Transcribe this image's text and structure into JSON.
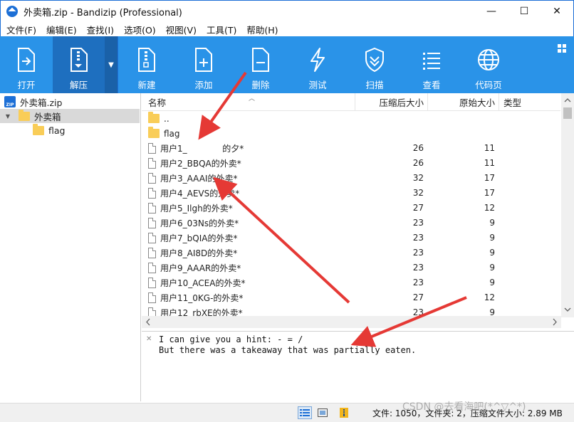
{
  "window": {
    "title": "外卖箱.zip - Bandizip (Professional)",
    "controls": {
      "minimize": "—",
      "maximize": "☐",
      "close": "✕"
    }
  },
  "menu": [
    "文件(F)",
    "编辑(E)",
    "查找(I)",
    "选项(O)",
    "视图(V)",
    "工具(T)",
    "帮助(H)"
  ],
  "toolbar": {
    "open": "打开",
    "extract": "解压",
    "new": "新建",
    "add": "添加",
    "delete": "删除",
    "test": "测试",
    "scan": "扫描",
    "view": "查看",
    "codepage": "代码页"
  },
  "tree": {
    "root": "外卖箱.zip",
    "folder": "外卖箱",
    "child": "flag"
  },
  "columns": {
    "name": "名称",
    "compressed": "压缩后大小",
    "original": "原始大小",
    "type": "类型"
  },
  "rows": [
    {
      "name": "..",
      "csize": "",
      "osize": "",
      "kind": "folder"
    },
    {
      "name": "flag",
      "csize": "",
      "osize": "",
      "kind": "folder"
    },
    {
      "name": "用户1_             的夕*",
      "csize": "26",
      "osize": "11",
      "kind": "file"
    },
    {
      "name": "用户2_BBQA的外卖*",
      "csize": "26",
      "osize": "11",
      "kind": "file"
    },
    {
      "name": "用户3_AAAI的外卖*",
      "csize": "32",
      "osize": "17",
      "kind": "file"
    },
    {
      "name": "用户4_AEVS的外卖*",
      "csize": "32",
      "osize": "17",
      "kind": "file"
    },
    {
      "name": "用户5_Ilgh的外卖*",
      "csize": "27",
      "osize": "12",
      "kind": "file"
    },
    {
      "name": "用户6_03Ns的外卖*",
      "csize": "23",
      "osize": "9",
      "kind": "file"
    },
    {
      "name": "用户7_bQIA的外卖*",
      "csize": "23",
      "osize": "9",
      "kind": "file"
    },
    {
      "name": "用户8_AI8D的外卖*",
      "csize": "23",
      "osize": "9",
      "kind": "file"
    },
    {
      "name": "用户9_AAAR的外卖*",
      "csize": "23",
      "osize": "9",
      "kind": "file"
    },
    {
      "name": "用户10_ACEA的外卖*",
      "csize": "23",
      "osize": "9",
      "kind": "file"
    },
    {
      "name": "用户11_0KG-的外卖*",
      "csize": "27",
      "osize": "12",
      "kind": "file"
    },
    {
      "name": "用户12_rbXE的外卖*",
      "csize": "23",
      "osize": "9",
      "kind": "file"
    }
  ],
  "comment": {
    "line1": "I can give you a hint: - = /",
    "line2": "But there was a takeaway that was partially eaten."
  },
  "status": {
    "text": "文件: 1050，文件夹: 2，压缩文件大小: 2.89 MB"
  },
  "watermark": "CSDN @去看海吧(*^▽^*)",
  "colors": {
    "toolbar": "#2a93e8",
    "toolbar_active": "#1e6fbf",
    "annotation": "#e53935"
  }
}
